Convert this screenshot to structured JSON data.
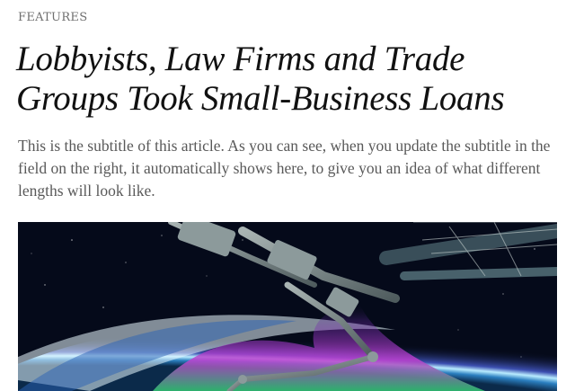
{
  "section": {
    "label": "FEATURES"
  },
  "article": {
    "headline": "Lobbyists, Law Firms and Trade Groups Took Small-Business Loans",
    "subtitle": "This is the subtitle of this article. As you can see, when you update the subtitle in the field on the right, it automatically shows here, to give you an idea of what different lengths will look like."
  },
  "hero_image": {
    "subject": "space station robotic arm above earth with aurora",
    "colors": {
      "space": "#050a1a",
      "earth_glow": "#8fd7ff",
      "aurora_pink": "#d53bd0",
      "aurora_green": "#3cd07a",
      "station_metal": "#7c8a8c"
    }
  }
}
